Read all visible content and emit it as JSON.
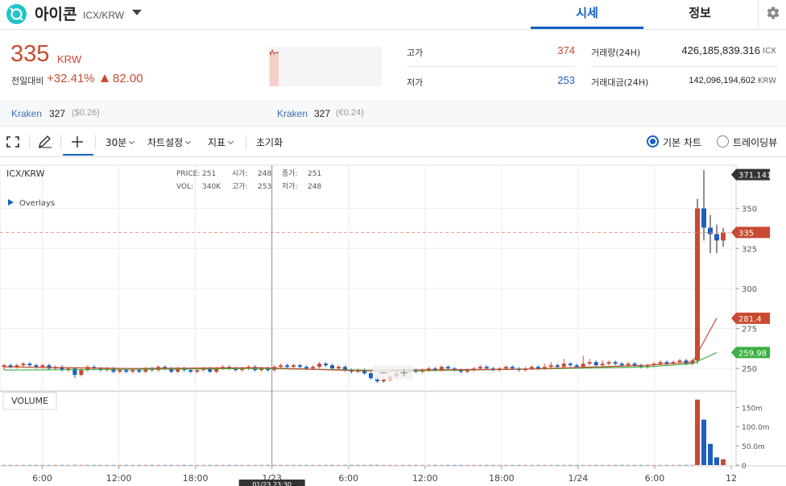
{
  "header": {
    "coin_name": "아이콘",
    "pair": "ICX/KRW",
    "tabs": [
      "시세",
      "정보"
    ]
  },
  "price": {
    "current": "335",
    "unit": "KRW",
    "change_label": "전일대비",
    "change_rate": "+32.41%",
    "change_amount": "82.00"
  },
  "stats": {
    "high_label": "고가",
    "high": "374",
    "low_label": "저가",
    "low": "253",
    "volume_label": "거래량(24H)",
    "volume": "426,185,839.316",
    "volume_unit": "ICX",
    "value_label": "거래대금(24H)",
    "value": "142,096,194,602",
    "value_unit": "KRW"
  },
  "exchanges": [
    {
      "name": "Kraken",
      "price": "327",
      "conv": "($0.26)"
    },
    {
      "name": "Kraken",
      "price": "327",
      "conv": "(€0.24)"
    }
  ],
  "toolbar": {
    "interval": "30분",
    "chart_settings": "차트설정",
    "indicators": "지표",
    "reset": "초기화",
    "basic_chart": "기본 차트",
    "tradingview": "트레이딩뷰"
  },
  "colors": {
    "up": "#c84a31",
    "down": "#1c5fbf",
    "accent": "#1261c4",
    "ma_green": "#3cb043"
  },
  "chart_data": {
    "type": "candlestick",
    "symbol": "ICX/KRW",
    "legend": {
      "price_label": "PRICE:",
      "price": "251",
      "open_label": "시가:",
      "open": "248",
      "close_label": "종가:",
      "close": "251",
      "vol_label": "VOL:",
      "vol": "340K",
      "high_label": "고가:",
      "high": "253",
      "low_label": "저가:",
      "low": "248"
    },
    "overlays_label": "Overlays",
    "volume_label": "VOLUME",
    "price_axis_ticks": [
      250,
      275,
      300,
      325,
      350
    ],
    "volume_axis_ticks": [
      "150m",
      "100.0m",
      "50.0m",
      "0"
    ],
    "volume_axis_values": [
      150,
      100,
      50,
      0
    ],
    "volume_range": [
      0,
      180
    ],
    "x_tick_labels": [
      "6:00",
      "12:00",
      "18:00",
      "1/23",
      "6:00",
      "12:00",
      "18:00",
      "1/24",
      "6:00",
      "12"
    ],
    "x_tick_hours": [
      6,
      12,
      18,
      24,
      30,
      36,
      42,
      48,
      54,
      60
    ],
    "crosshair_time": "01/23 23:30",
    "crosshair_hour": 24,
    "y_range": [
      236,
      376
    ],
    "x_range": [
      3,
      60
    ],
    "labels": {
      "max": "371.141",
      "current": "335",
      "ma1": "281.4",
      "ma2": "259.98"
    },
    "label_values": {
      "max": 371.141,
      "current": 335,
      "ma1": 281.4,
      "ma2": 259.98
    },
    "candles": [
      {
        "o": 251,
        "c": 252,
        "h": 253,
        "l": 249,
        "v": 0.3
      },
      {
        "o": 252,
        "c": 251,
        "h": 253,
        "l": 250,
        "v": 0.3
      },
      {
        "o": 251,
        "c": 252,
        "h": 253,
        "l": 250,
        "v": 0.3
      },
      {
        "o": 252,
        "c": 253,
        "h": 254,
        "l": 251,
        "v": 0.3
      },
      {
        "o": 253,
        "c": 252,
        "h": 254,
        "l": 251,
        "v": 0.3
      },
      {
        "o": 252,
        "c": 251,
        "h": 253,
        "l": 250,
        "v": 0.3
      },
      {
        "o": 251,
        "c": 252,
        "h": 253,
        "l": 250,
        "v": 0.3
      },
      {
        "o": 252,
        "c": 250,
        "h": 253,
        "l": 249,
        "v": 0.3
      },
      {
        "o": 250,
        "c": 251,
        "h": 252,
        "l": 249,
        "v": 0.3
      },
      {
        "o": 251,
        "c": 249,
        "h": 252,
        "l": 248,
        "v": 0.3
      },
      {
        "o": 249,
        "c": 250,
        "h": 251,
        "l": 248,
        "v": 0.3
      },
      {
        "o": 250,
        "c": 246,
        "h": 251,
        "l": 244,
        "v": 0.5
      },
      {
        "o": 246,
        "c": 249,
        "h": 250,
        "l": 245,
        "v": 0.4
      },
      {
        "o": 249,
        "c": 251,
        "h": 252,
        "l": 248,
        "v": 0.3
      },
      {
        "o": 251,
        "c": 250,
        "h": 252,
        "l": 249,
        "v": 0.3
      },
      {
        "o": 250,
        "c": 249,
        "h": 251,
        "l": 248,
        "v": 0.3
      },
      {
        "o": 249,
        "c": 250,
        "h": 251,
        "l": 248,
        "v": 0.3
      },
      {
        "o": 250,
        "c": 248,
        "h": 251,
        "l": 247,
        "v": 0.3
      },
      {
        "o": 248,
        "c": 249,
        "h": 250,
        "l": 247,
        "v": 0.3
      },
      {
        "o": 249,
        "c": 248,
        "h": 250,
        "l": 247,
        "v": 0.3
      },
      {
        "o": 248,
        "c": 249,
        "h": 250,
        "l": 247,
        "v": 0.3
      },
      {
        "o": 249,
        "c": 248,
        "h": 250,
        "l": 247,
        "v": 0.3
      },
      {
        "o": 248,
        "c": 250,
        "h": 251,
        "l": 247,
        "v": 0.3
      },
      {
        "o": 250,
        "c": 249,
        "h": 251,
        "l": 248,
        "v": 0.3
      },
      {
        "o": 249,
        "c": 251,
        "h": 252,
        "l": 248,
        "v": 0.3
      },
      {
        "o": 251,
        "c": 250,
        "h": 252,
        "l": 249,
        "v": 0.3
      },
      {
        "o": 250,
        "c": 248,
        "h": 251,
        "l": 247,
        "v": 0.3
      },
      {
        "o": 248,
        "c": 250,
        "h": 251,
        "l": 247,
        "v": 0.3
      },
      {
        "o": 250,
        "c": 249,
        "h": 251,
        "l": 248,
        "v": 0.3
      },
      {
        "o": 249,
        "c": 248,
        "h": 250,
        "l": 247,
        "v": 0.3
      },
      {
        "o": 248,
        "c": 249,
        "h": 250,
        "l": 247,
        "v": 0.3
      },
      {
        "o": 249,
        "c": 250,
        "h": 251,
        "l": 248,
        "v": 0.3
      },
      {
        "o": 250,
        "c": 248,
        "h": 251,
        "l": 247,
        "v": 0.3
      },
      {
        "o": 248,
        "c": 250,
        "h": 251,
        "l": 247,
        "v": 0.3
      },
      {
        "o": 250,
        "c": 251,
        "h": 252,
        "l": 249,
        "v": 0.3
      },
      {
        "o": 251,
        "c": 250,
        "h": 252,
        "l": 249,
        "v": 0.3
      },
      {
        "o": 250,
        "c": 249,
        "h": 251,
        "l": 248,
        "v": 0.3
      },
      {
        "o": 249,
        "c": 250,
        "h": 251,
        "l": 248,
        "v": 0.3
      },
      {
        "o": 250,
        "c": 251,
        "h": 252,
        "l": 249,
        "v": 0.3
      },
      {
        "o": 251,
        "c": 249,
        "h": 252,
        "l": 248,
        "v": 0.3
      },
      {
        "o": 249,
        "c": 250,
        "h": 251,
        "l": 248,
        "v": 0.3
      },
      {
        "o": 250,
        "c": 249,
        "h": 251,
        "l": 248,
        "v": 0.3
      },
      {
        "o": 249,
        "c": 251,
        "h": 252,
        "l": 248,
        "v": 0.3
      },
      {
        "o": 251,
        "c": 252,
        "h": 253,
        "l": 250,
        "v": 0.3
      },
      {
        "o": 252,
        "c": 251,
        "h": 253,
        "l": 250,
        "v": 0.3
      },
      {
        "o": 251,
        "c": 252,
        "h": 253,
        "l": 250,
        "v": 0.3
      },
      {
        "o": 252,
        "c": 251,
        "h": 253,
        "l": 250,
        "v": 0.3
      },
      {
        "o": 251,
        "c": 250,
        "h": 252,
        "l": 249,
        "v": 0.3
      },
      {
        "o": 250,
        "c": 251,
        "h": 252,
        "l": 249,
        "v": 0.3
      },
      {
        "o": 251,
        "c": 253,
        "h": 254,
        "l": 250,
        "v": 0.3
      },
      {
        "o": 253,
        "c": 252,
        "h": 254,
        "l": 251,
        "v": 0.3
      },
      {
        "o": 252,
        "c": 250,
        "h": 253,
        "l": 249,
        "v": 0.3
      },
      {
        "o": 250,
        "c": 251,
        "h": 252,
        "l": 249,
        "v": 0.3
      },
      {
        "o": 251,
        "c": 249,
        "h": 252,
        "l": 248,
        "v": 0.3
      },
      {
        "o": 249,
        "c": 248,
        "h": 250,
        "l": 247,
        "v": 0.3
      },
      {
        "o": 248,
        "c": 249,
        "h": 250,
        "l": 247,
        "v": 0.3
      },
      {
        "o": 249,
        "c": 247,
        "h": 250,
        "l": 246,
        "v": 0.3
      },
      {
        "o": 247,
        "c": 244,
        "h": 248,
        "l": 243,
        "v": 0.4
      },
      {
        "o": 244,
        "c": 242,
        "h": 245,
        "l": 241,
        "v": 0.4
      },
      {
        "o": 242,
        "c": 243,
        "h": 244,
        "l": 241,
        "v": 0.3
      },
      {
        "o": 243,
        "c": 245,
        "h": 246,
        "l": 242,
        "v": 0.3
      },
      {
        "o": 245,
        "c": 247,
        "h": 248,
        "l": 244,
        "v": 0.3
      },
      {
        "o": 247,
        "c": 248,
        "h": 249,
        "l": 246,
        "v": 0.3
      },
      {
        "o": 248,
        "c": 249,
        "h": 250,
        "l": 247,
        "v": 0.3
      },
      {
        "o": 249,
        "c": 248,
        "h": 250,
        "l": 247,
        "v": 0.3
      },
      {
        "o": 248,
        "c": 249,
        "h": 250,
        "l": 247,
        "v": 0.3
      },
      {
        "o": 249,
        "c": 250,
        "h": 251,
        "l": 248,
        "v": 0.3
      },
      {
        "o": 250,
        "c": 249,
        "h": 251,
        "l": 248,
        "v": 0.3
      },
      {
        "o": 249,
        "c": 251,
        "h": 252,
        "l": 248,
        "v": 0.3
      },
      {
        "o": 251,
        "c": 250,
        "h": 252,
        "l": 249,
        "v": 0.3
      },
      {
        "o": 250,
        "c": 249,
        "h": 251,
        "l": 248,
        "v": 0.3
      },
      {
        "o": 249,
        "c": 248,
        "h": 250,
        "l": 247,
        "v": 0.3
      },
      {
        "o": 248,
        "c": 249,
        "h": 250,
        "l": 247,
        "v": 0.3
      },
      {
        "o": 249,
        "c": 250,
        "h": 251,
        "l": 248,
        "v": 0.3
      },
      {
        "o": 250,
        "c": 251,
        "h": 252,
        "l": 249,
        "v": 0.3
      },
      {
        "o": 251,
        "c": 250,
        "h": 252,
        "l": 249,
        "v": 0.3
      },
      {
        "o": 250,
        "c": 249,
        "h": 251,
        "l": 248,
        "v": 0.3
      },
      {
        "o": 249,
        "c": 250,
        "h": 251,
        "l": 248,
        "v": 0.3
      },
      {
        "o": 250,
        "c": 251,
        "h": 252,
        "l": 249,
        "v": 0.3
      },
      {
        "o": 251,
        "c": 250,
        "h": 252,
        "l": 249,
        "v": 0.3
      },
      {
        "o": 250,
        "c": 249,
        "h": 251,
        "l": 248,
        "v": 0.3
      },
      {
        "o": 249,
        "c": 250,
        "h": 251,
        "l": 248,
        "v": 0.3
      },
      {
        "o": 250,
        "c": 251,
        "h": 252,
        "l": 249,
        "v": 0.3
      },
      {
        "o": 251,
        "c": 250,
        "h": 252,
        "l": 249,
        "v": 0.3
      },
      {
        "o": 250,
        "c": 251,
        "h": 253,
        "l": 249,
        "v": 0.3
      },
      {
        "o": 251,
        "c": 252,
        "h": 254,
        "l": 250,
        "v": 0.3
      },
      {
        "o": 252,
        "c": 251,
        "h": 253,
        "l": 250,
        "v": 0.3
      },
      {
        "o": 251,
        "c": 253,
        "h": 256,
        "l": 250,
        "v": 0.3
      },
      {
        "o": 253,
        "c": 252,
        "h": 254,
        "l": 251,
        "v": 0.3
      },
      {
        "o": 252,
        "c": 251,
        "h": 253,
        "l": 250,
        "v": 0.3
      },
      {
        "o": 251,
        "c": 253,
        "h": 258,
        "l": 250,
        "v": 0.3
      },
      {
        "o": 253,
        "c": 254,
        "h": 256,
        "l": 252,
        "v": 0.3
      },
      {
        "o": 254,
        "c": 252,
        "h": 255,
        "l": 251,
        "v": 0.3
      },
      {
        "o": 252,
        "c": 253,
        "h": 255,
        "l": 251,
        "v": 0.3
      },
      {
        "o": 253,
        "c": 254,
        "h": 255,
        "l": 252,
        "v": 0.3
      },
      {
        "o": 254,
        "c": 253,
        "h": 255,
        "l": 252,
        "v": 0.3
      },
      {
        "o": 253,
        "c": 252,
        "h": 254,
        "l": 251,
        "v": 0.3
      },
      {
        "o": 252,
        "c": 253,
        "h": 254,
        "l": 251,
        "v": 0.3
      },
      {
        "o": 253,
        "c": 252,
        "h": 254,
        "l": 251,
        "v": 0.3
      },
      {
        "o": 252,
        "c": 251,
        "h": 253,
        "l": 250,
        "v": 0.3
      },
      {
        "o": 251,
        "c": 252,
        "h": 253,
        "l": 250,
        "v": 0.3
      },
      {
        "o": 252,
        "c": 253,
        "h": 254,
        "l": 251,
        "v": 0.3
      },
      {
        "o": 253,
        "c": 254,
        "h": 255,
        "l": 252,
        "v": 0.3
      },
      {
        "o": 254,
        "c": 253,
        "h": 255,
        "l": 252,
        "v": 0.3
      },
      {
        "o": 253,
        "c": 254,
        "h": 255,
        "l": 252,
        "v": 0.3
      },
      {
        "o": 254,
        "c": 255,
        "h": 256,
        "l": 253,
        "v": 0.3
      },
      {
        "o": 255,
        "c": 253,
        "h": 256,
        "l": 252,
        "v": 0.3
      },
      {
        "o": 253,
        "c": 255,
        "h": 256,
        "l": 252,
        "v": 0.3
      },
      {
        "o": 255,
        "c": 350,
        "h": 356,
        "l": 253,
        "v": 170
      },
      {
        "o": 350,
        "c": 338,
        "h": 374,
        "l": 330,
        "v": 118
      },
      {
        "o": 338,
        "c": 334,
        "h": 346,
        "l": 322,
        "v": 55
      },
      {
        "o": 334,
        "c": 330,
        "h": 340,
        "l": 322,
        "v": 20
      },
      {
        "o": 330,
        "c": 335,
        "h": 338,
        "l": 326,
        "v": 15
      }
    ],
    "ma_red": [
      {
        "i": 0,
        "v": 251
      },
      {
        "i": 20,
        "v": 250
      },
      {
        "i": 40,
        "v": 250.5
      },
      {
        "i": 56,
        "v": 248.5
      },
      {
        "i": 62,
        "v": 249
      },
      {
        "i": 80,
        "v": 249.5
      },
      {
        "i": 100,
        "v": 252
      },
      {
        "i": 107,
        "v": 254
      },
      {
        "i": 111,
        "v": 281.4
      }
    ],
    "ma_green": [
      {
        "i": 0,
        "v": 249
      },
      {
        "i": 20,
        "v": 249.5
      },
      {
        "i": 40,
        "v": 250
      },
      {
        "i": 56,
        "v": 249
      },
      {
        "i": 62,
        "v": 248.5
      },
      {
        "i": 80,
        "v": 249.5
      },
      {
        "i": 100,
        "v": 251
      },
      {
        "i": 107,
        "v": 253
      },
      {
        "i": 111,
        "v": 259.98
      }
    ]
  }
}
